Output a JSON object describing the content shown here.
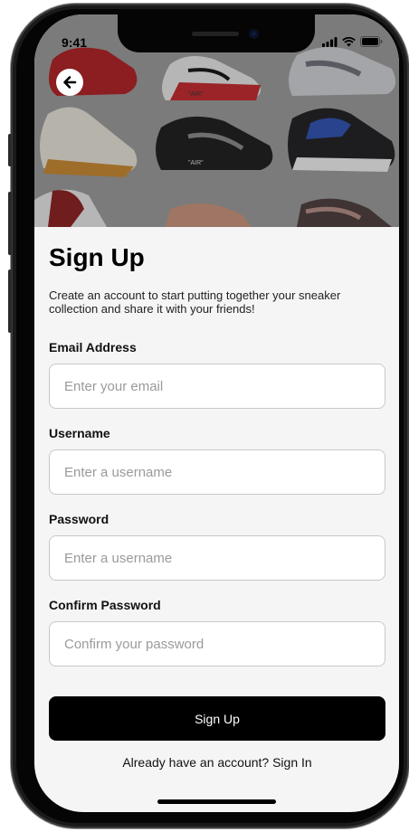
{
  "status_bar": {
    "time": "9:41"
  },
  "screen": {
    "title": "Sign Up",
    "subtitle": "Create an account to start putting together your sneaker collection and share it with your friends!"
  },
  "form": {
    "email": {
      "label": "Email Address",
      "placeholder": "Enter your email",
      "value": ""
    },
    "username": {
      "label": "Username",
      "placeholder": "Enter a username",
      "value": ""
    },
    "password": {
      "label": "Password",
      "placeholder": "Enter a username",
      "value": ""
    },
    "confirm_password": {
      "label": "Confirm Password",
      "placeholder": "Confirm your password",
      "value": ""
    }
  },
  "actions": {
    "submit_label": "Sign Up",
    "signin_link": "Already have an account? Sign In"
  },
  "hero": {
    "shoe_labels": [
      "\"AIR\"",
      "\"AIR\""
    ]
  },
  "colors": {
    "primary_button": "#000000",
    "background": "#f5f5f5",
    "input_border": "#c8c8c8"
  },
  "icons": {
    "back": "arrow-left-icon",
    "signal": "signal-icon",
    "wifi": "wifi-icon",
    "battery": "battery-icon"
  }
}
